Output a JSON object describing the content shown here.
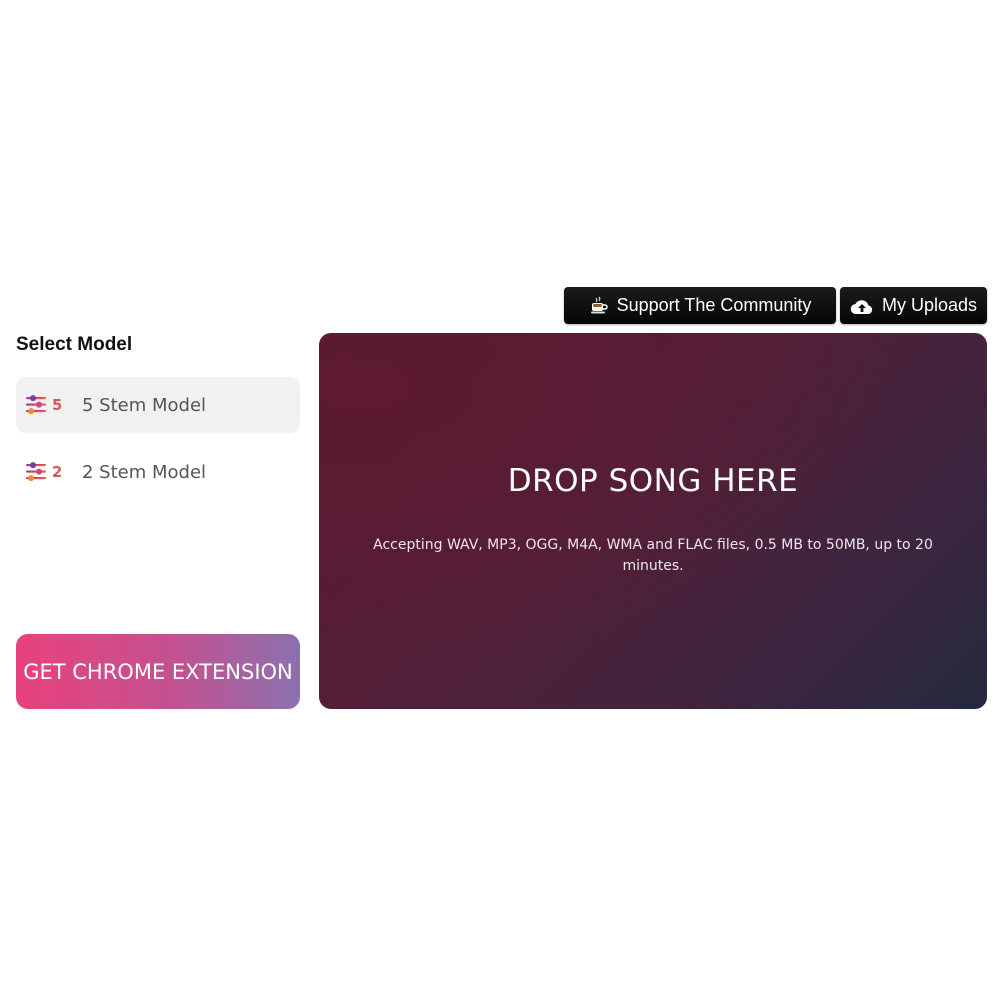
{
  "header": {
    "support_label": "Support The Community",
    "support_icon": "coffee-icon",
    "uploads_label": "My Uploads",
    "uploads_icon": "cloud-upload-icon"
  },
  "sidebar": {
    "title": "Select Model",
    "models": [
      {
        "number": "5",
        "label": "5 Stem Model",
        "selected": true,
        "icon": "sliders-icon"
      },
      {
        "number": "2",
        "label": "2 Stem Model",
        "selected": false,
        "icon": "sliders-icon"
      }
    ],
    "chrome_button_label": "GET CHROME EXTENSION"
  },
  "drop_zone": {
    "title": "DROP SONG HERE",
    "subtitle": "Accepting WAV, MP3, OGG, M4A, WMA and FLAC files, 0.5 MB to 50MB, up to 20 minutes."
  },
  "colors": {
    "accent_pink": "#e8427c",
    "accent_purple": "#8b71af",
    "drop_bg": "#5b1a32",
    "button_dark": "#0a0a0a"
  }
}
